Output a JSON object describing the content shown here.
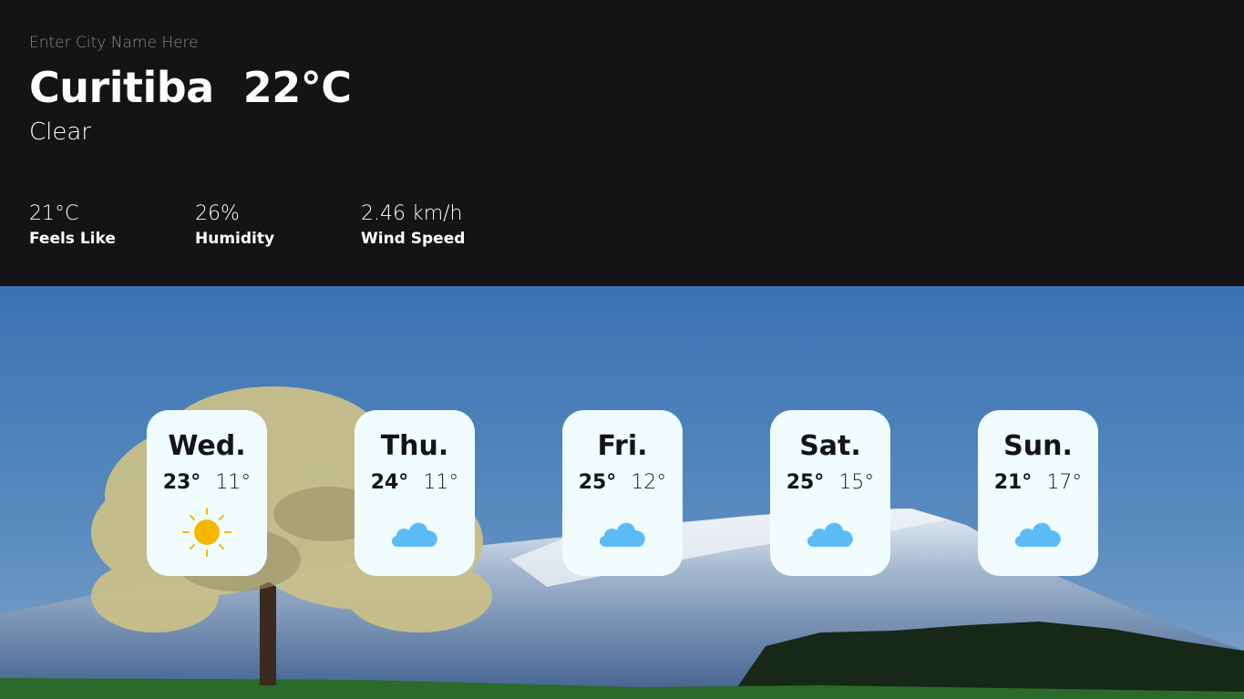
{
  "search": {
    "placeholder": "Enter City Name Here"
  },
  "current": {
    "city": "Curitiba",
    "temperature": "22°C",
    "condition": "Clear"
  },
  "stats": [
    {
      "value": "21°C",
      "label": "Feels Like"
    },
    {
      "value": "26%",
      "label": "Humidity"
    },
    {
      "value": "2.46 km/h",
      "label": "Wind Speed"
    }
  ],
  "forecast": [
    {
      "day": "Wed.",
      "high": "23°",
      "low": "11°",
      "icon": "sun-icon"
    },
    {
      "day": "Thu.",
      "high": "24°",
      "low": "11°",
      "icon": "cloud-icon"
    },
    {
      "day": "Fri.",
      "high": "25°",
      "low": "12°",
      "icon": "cloud-icon"
    },
    {
      "day": "Sat.",
      "high": "25°",
      "low": "15°",
      "icon": "cloud-icon"
    },
    {
      "day": "Sun.",
      "high": "21°",
      "low": "17°",
      "icon": "cloud-icon"
    }
  ],
  "colors": {
    "header_bg": "#141414",
    "card_bg": "#f0fcfd",
    "sun": "#f5b800",
    "cloud": "#5bbcf5"
  }
}
